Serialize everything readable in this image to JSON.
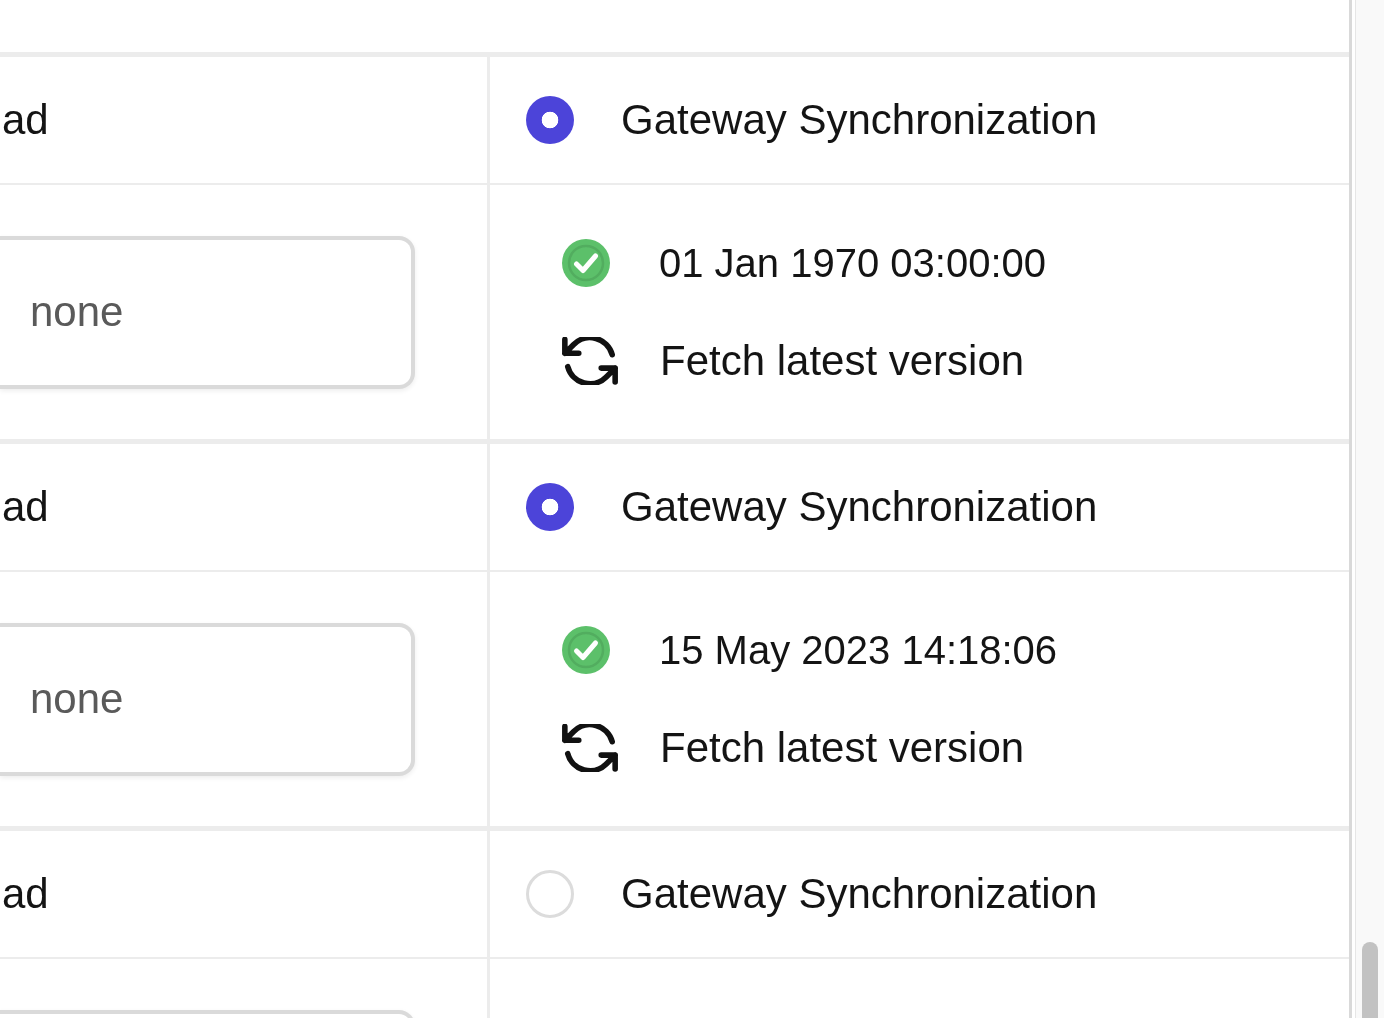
{
  "rows": [
    {
      "name": "ad",
      "sync_source": {
        "label": "Gateway Synchronization",
        "selected": true
      },
      "value_field": {
        "value": "none"
      },
      "last_sync": "01 Jan 1970 03:00:00",
      "fetch_action": "Fetch latest version"
    },
    {
      "name": "ad",
      "sync_source": {
        "label": "Gateway Synchronization",
        "selected": true
      },
      "value_field": {
        "value": "none"
      },
      "last_sync": "15 May 2023 14:18:06",
      "fetch_action": "Fetch latest version"
    },
    {
      "name": "ad",
      "sync_source": {
        "label": "Gateway Synchronization",
        "selected": false
      },
      "value_field": {}
    }
  ]
}
